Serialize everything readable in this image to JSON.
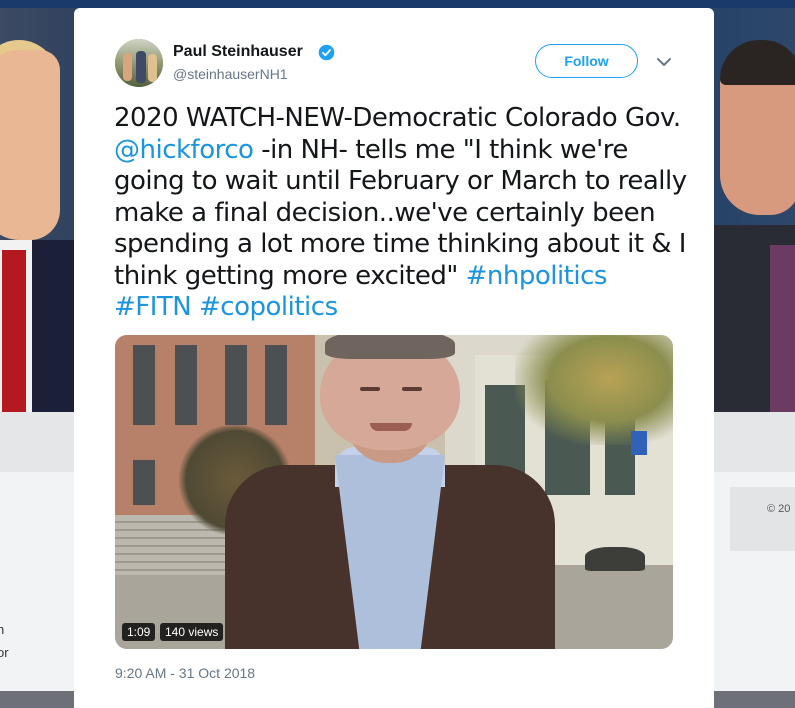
{
  "tweet": {
    "author_name": "Paul Steinhauser",
    "handle": "@steinhauserNH1",
    "follow_label": "Follow",
    "text_plain_1": "2020 WATCH-NEW-Democratic Colorado Gov. ",
    "mention": "@hickforco",
    "text_plain_2": " -in NH- tells me \"I think we're going to wait until February or March to really make a final decision..we've certainly been spending a lot more time thinking about it & I think getting more excited\"",
    "hashtag_1": "#nhpolitics",
    "hashtag_2": "#FITN",
    "hashtag_3": "#copolitics",
    "video": {
      "duration": "1:09",
      "views": "140 views"
    },
    "timestamp": "9:20 AM - 31 Oct 2018"
  },
  "background": {
    "copyright_fragment": "© 20",
    "left_text_1": "n",
    "left_text_2": "or"
  },
  "colors": {
    "link": "#1b95e0",
    "follow_border": "#1da1f2",
    "meta_gray": "#657786",
    "verified": "#1da1f2"
  },
  "icons": [
    "verified-badge-icon",
    "chevron-down-icon"
  ]
}
